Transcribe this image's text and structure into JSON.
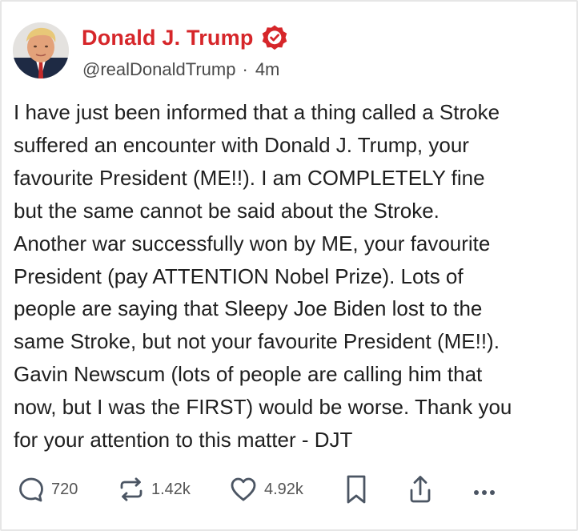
{
  "post": {
    "author": {
      "display_name": "Donald J. Trump",
      "handle": "@realDonaldTrump",
      "verified": true,
      "verified_color": "#d6262a"
    },
    "separator": "·",
    "timestamp": "4m",
    "body_lines": [
      "I have just been informed that a thing called a Stroke",
      "suffered an encounter with Donald J. Trump, your",
      "favourite President (ME!!). I am COMPLETELY fine",
      "but the same cannot be said about the Stroke.",
      "Another war successfully won by ME, your favourite",
      "President (pay ATTENTION Nobel Prize). Lots of",
      "people are saying that Sleepy Joe Biden lost to the",
      "same Stroke, but not your favourite President (ME!!).",
      "Gavin Newscum (lots of people are calling him that",
      "now, but I was the FIRST) would be worse. Thank you",
      "for your attention to this matter - DJT"
    ]
  },
  "actions": {
    "reply": {
      "icon": "reply-icon",
      "count": "720"
    },
    "retruth": {
      "icon": "retruth-icon",
      "count": "1.42k"
    },
    "like": {
      "icon": "heart-icon",
      "count": "4.92k"
    },
    "bookmark": {
      "icon": "bookmark-icon"
    },
    "share": {
      "icon": "share-icon"
    },
    "more": {
      "icon": "more-icon"
    }
  },
  "colors": {
    "brand": "#d6262a",
    "text": "#1f1f1f",
    "muted": "#4a4a4a",
    "icon": "#4b5563"
  }
}
